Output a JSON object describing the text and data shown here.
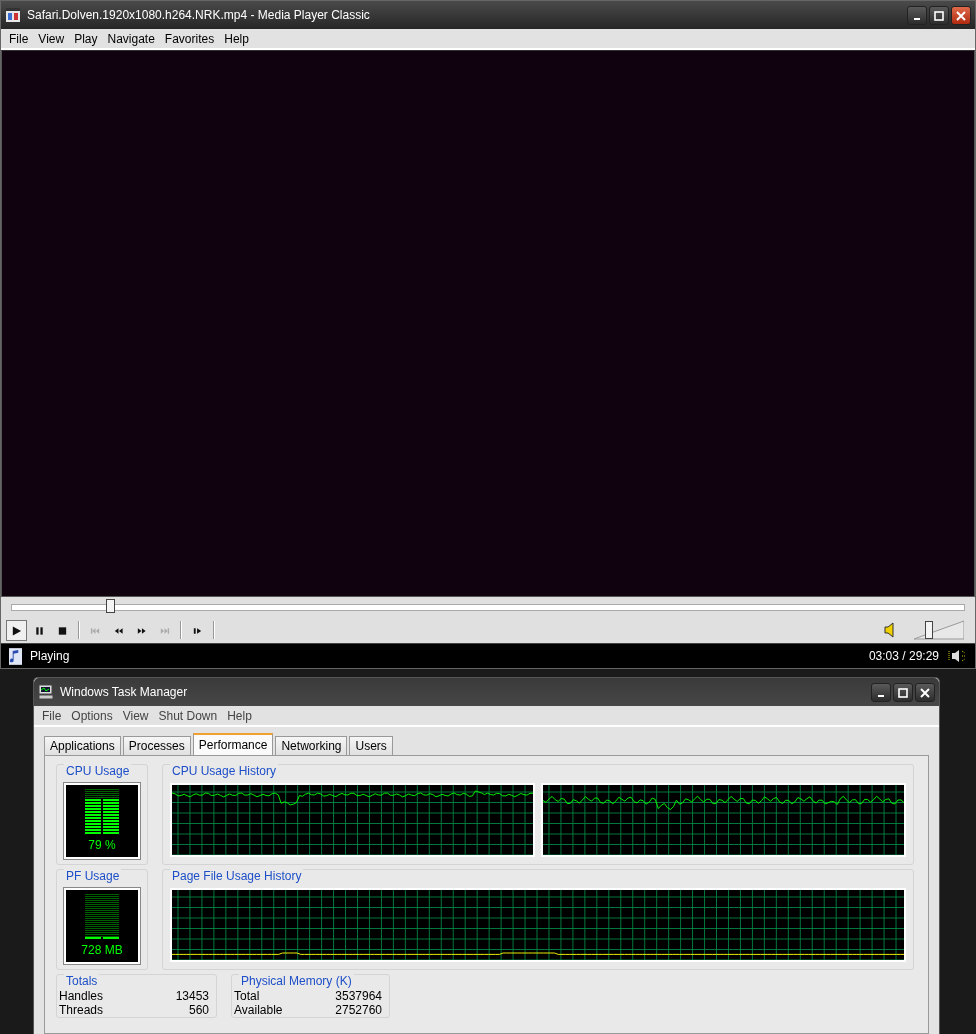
{
  "player": {
    "title": "Safari.Dolven.1920x1080.h264.NRK.mp4 - Media Player Classic",
    "menu": [
      "File",
      "View",
      "Play",
      "Navigate",
      "Favorites",
      "Help"
    ],
    "seek": {
      "level": 0.103
    },
    "controls": [
      {
        "kind": "play",
        "pressed": true,
        "disabled": false
      },
      {
        "kind": "pause",
        "pressed": false,
        "disabled": false
      },
      {
        "kind": "stop",
        "pressed": false,
        "disabled": false
      },
      {
        "kind": "separator"
      },
      {
        "kind": "prev",
        "pressed": false,
        "disabled": true
      },
      {
        "kind": "rewind",
        "pressed": false,
        "disabled": false
      },
      {
        "kind": "forward",
        "pressed": false,
        "disabled": false
      },
      {
        "kind": "next",
        "pressed": false,
        "disabled": true
      },
      {
        "kind": "separator"
      },
      {
        "kind": "step",
        "pressed": false,
        "disabled": false
      },
      {
        "kind": "separator"
      }
    ],
    "volume": {
      "level": 0.3
    },
    "status": "Playing",
    "time": "03:03 / 29:29"
  },
  "task_manager": {
    "title": "Windows Task Manager",
    "menu": [
      "File",
      "Options",
      "View",
      "Shut Down",
      "Help"
    ],
    "tabs": [
      {
        "label": "Applications",
        "selected": false
      },
      {
        "label": "Processes",
        "selected": false
      },
      {
        "label": "Performance",
        "selected": true
      },
      {
        "label": "Networking",
        "selected": false
      },
      {
        "label": "Users",
        "selected": false
      }
    ],
    "cpu_usage": {
      "label": "CPU Usage",
      "reading": "79 %",
      "level": 0.79
    },
    "cpu_history": {
      "label": "CPU Usage History"
    },
    "pf_usage": {
      "label": "PF Usage",
      "reading": "728 MB",
      "level": 0.05
    },
    "pf_history": {
      "label": "Page File Usage History"
    },
    "totals": {
      "label": "Totals",
      "rows": [
        {
          "name": "Handles",
          "value": "13453"
        },
        {
          "name": "Threads",
          "value": "560"
        }
      ]
    },
    "physical_memory": {
      "label": "Physical Memory (K)",
      "rows": [
        {
          "name": "Total",
          "value": "3537964"
        },
        {
          "name": "Available",
          "value": "2752760"
        }
      ]
    }
  }
}
